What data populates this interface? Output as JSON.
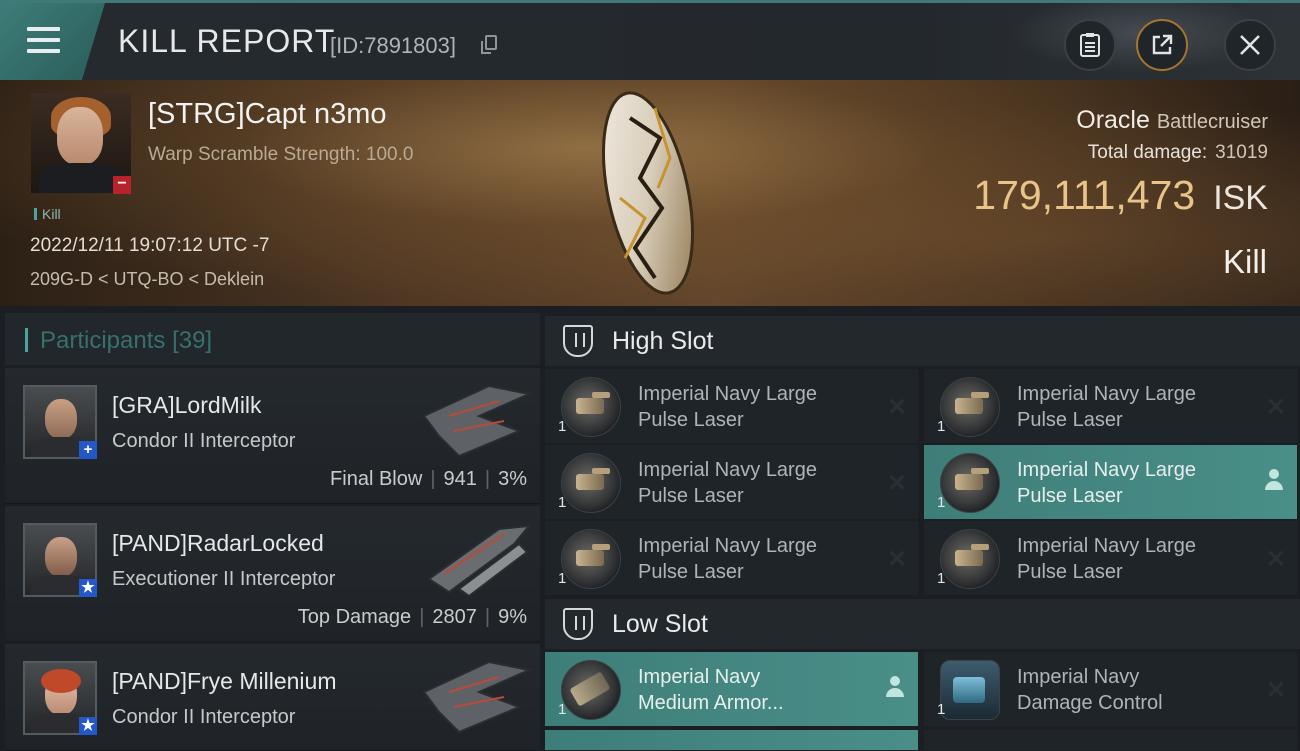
{
  "header": {
    "title": "KILL REPORT",
    "report_id": "[ID:7891803]",
    "icons": [
      "menu-icon",
      "copy-icon",
      "clipboard-icon",
      "external-link-icon",
      "close-icon"
    ]
  },
  "victim": {
    "name": "[STRG]Capt n3mo",
    "warp_scramble": "Warp Scramble Strength: 100.0",
    "tag": "Kill",
    "datetime": "2022/12/11 19:07:12 UTC -7",
    "location": "209G-D < UTQ-BO < Deklein",
    "ship_name": "Oracle",
    "ship_class": "Battlecruiser",
    "total_damage_label": "Total damage:",
    "total_damage": "31019",
    "isk_value": "179,111,473",
    "isk_unit": "ISK",
    "result": "Kill"
  },
  "participants": {
    "label": "Participants",
    "count": "[39]",
    "items": [
      {
        "name": "[GRA]LordMilk",
        "ship": "Condor II Interceptor",
        "role": "Final Blow",
        "damage": "941",
        "percent": "3%",
        "badge": "+"
      },
      {
        "name": "[PAND]RadarLocked",
        "ship": "Executioner II Interceptor",
        "role": "Top Damage",
        "damage": "2807",
        "percent": "9%",
        "badge": "★"
      },
      {
        "name": "[PAND]Frye Millenium",
        "ship": "Condor II Interceptor",
        "role": "",
        "damage": "",
        "percent": "",
        "badge": "★"
      }
    ]
  },
  "slots": {
    "high": {
      "label": "High Slot",
      "modules": [
        {
          "qty": "1",
          "line1": "Imperial Navy Large",
          "line2": "Pulse Laser",
          "highlighted": false
        },
        {
          "qty": "1",
          "line1": "Imperial Navy Large",
          "line2": "Pulse Laser",
          "highlighted": false
        },
        {
          "qty": "1",
          "line1": "Imperial Navy Large",
          "line2": "Pulse Laser",
          "highlighted": false
        },
        {
          "qty": "1",
          "line1": "Imperial Navy Large",
          "line2": "Pulse Laser",
          "highlighted": true
        },
        {
          "qty": "1",
          "line1": "Imperial Navy Large",
          "line2": "Pulse Laser",
          "highlighted": false
        },
        {
          "qty": "1",
          "line1": "Imperial Navy Large",
          "line2": "Pulse Laser",
          "highlighted": false
        }
      ]
    },
    "low": {
      "label": "Low Slot",
      "modules": [
        {
          "qty": "1",
          "line1": "Imperial Navy",
          "line2": "Medium Armor...",
          "highlighted": true
        },
        {
          "qty": "1",
          "line1": "Imperial Navy",
          "line2": "Damage Control",
          "highlighted": false
        }
      ]
    }
  },
  "colors": {
    "accent": "#4aa59d",
    "highlight_row": "#3e7e79",
    "isk_gold": "#e8c48a",
    "kill_badge": "#b8232a",
    "ally_badge": "#2458c9"
  }
}
